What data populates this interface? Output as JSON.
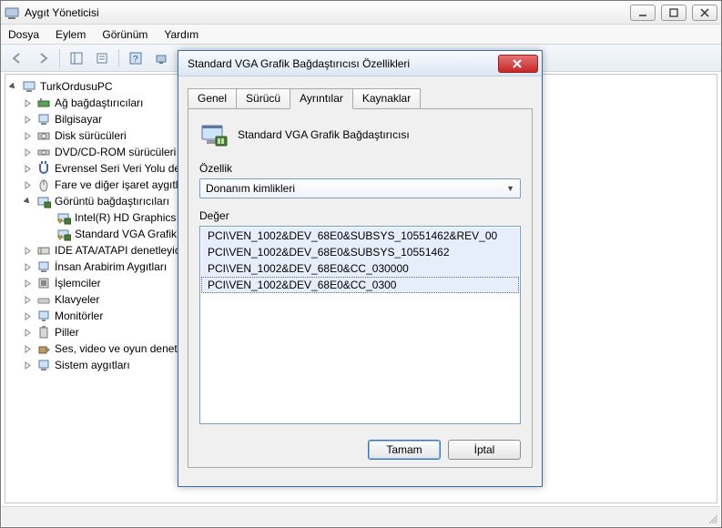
{
  "main_window": {
    "title": "Aygıt Yöneticisi",
    "menu": {
      "file": "Dosya",
      "action": "Eylem",
      "view": "Görünüm",
      "help": "Yardım"
    }
  },
  "tree": {
    "root": "TurkOrdusuPC",
    "items": [
      {
        "label": "Ağ bağdaştırıcıları"
      },
      {
        "label": "Bilgisayar"
      },
      {
        "label": "Disk sürücüleri"
      },
      {
        "label": "DVD/CD-ROM sürücüleri"
      },
      {
        "label": "Evrensel Seri Veri Yolu denetleyicileri"
      },
      {
        "label": "Fare ve diğer işaret aygıtları"
      },
      {
        "label": "Görüntü bağdaştırıcıları",
        "expanded": true,
        "children": [
          {
            "label": "Intel(R) HD Graphics"
          },
          {
            "label": "Standard VGA Grafik Bağdaştırıcısı"
          }
        ]
      },
      {
        "label": "IDE ATA/ATAPI denetleyicileri"
      },
      {
        "label": "İnsan Arabirim Aygıtları"
      },
      {
        "label": "İşlemciler"
      },
      {
        "label": "Klavyeler"
      },
      {
        "label": "Monitörler"
      },
      {
        "label": "Piller"
      },
      {
        "label": "Ses, video ve oyun denetleyicileri"
      },
      {
        "label": "Sistem aygıtları"
      }
    ]
  },
  "dialog": {
    "title": "Standard VGA Grafik Bağdaştırıcısı Özellikleri",
    "tabs": {
      "general": "Genel",
      "driver": "Sürücü",
      "details": "Ayrıntılar",
      "resources": "Kaynaklar"
    },
    "device_name": "Standard VGA Grafik Bağdaştırıcısı",
    "property_label": "Özellik",
    "property_selected": "Donanım kimlikleri",
    "value_label": "Değer",
    "values": [
      "PCI\\VEN_1002&DEV_68E0&SUBSYS_10551462&REV_00",
      "PCI\\VEN_1002&DEV_68E0&SUBSYS_10551462",
      "PCI\\VEN_1002&DEV_68E0&CC_030000",
      "PCI\\VEN_1002&DEV_68E0&CC_0300"
    ],
    "buttons": {
      "ok": "Tamam",
      "cancel": "İptal"
    }
  }
}
